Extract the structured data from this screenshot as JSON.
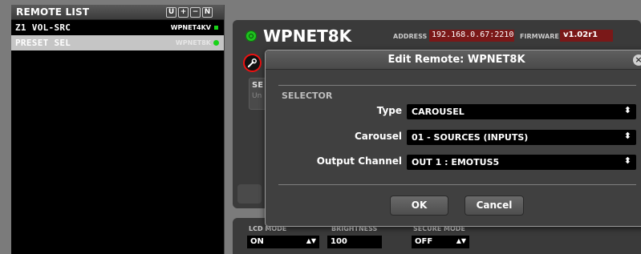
{
  "remote_list": {
    "title": "REMOTE LIST",
    "header_buttons": [
      "U",
      "+",
      "−",
      "N"
    ],
    "items": [
      {
        "name": "Z1 VOL-SRC",
        "model": "WPNET4KV",
        "status_color": "#18d318",
        "selected": false
      },
      {
        "name": "PRESET SEL",
        "model": "WPNET8K",
        "status_color": "#18d318",
        "selected": true
      }
    ]
  },
  "device": {
    "title": "WPNET8K",
    "address_label": "ADDRESS",
    "address": "192.168.0.67:2210",
    "firmware_label": "FIRMWARE",
    "firmware": "v1.02r1"
  },
  "background_box": {
    "title": "SE",
    "subtitle": "Un"
  },
  "bottom": {
    "lcd_mode_label": "LCD MODE",
    "lcd_mode": "ON",
    "brightness_label": "BRIGHTNESS",
    "brightness": "100",
    "secure_mode_label": "SECURE MODE",
    "secure_mode": "OFF"
  },
  "dialog": {
    "title": "Edit Remote: WPNET8K",
    "section": "SELECTOR",
    "type_label": "Type",
    "type_value": "CAROUSEL",
    "carousel_label": "Carousel",
    "carousel_value": "01 - SOURCES (INPUTS)",
    "output_label": "Output Channel",
    "output_value": "OUT 1 : EMOTUS5",
    "ok_label": "OK",
    "cancel_label": "Cancel"
  },
  "colors": {
    "accent_green": "#18d318",
    "value_red": "#7a1818",
    "alert_red": "#e11111"
  }
}
